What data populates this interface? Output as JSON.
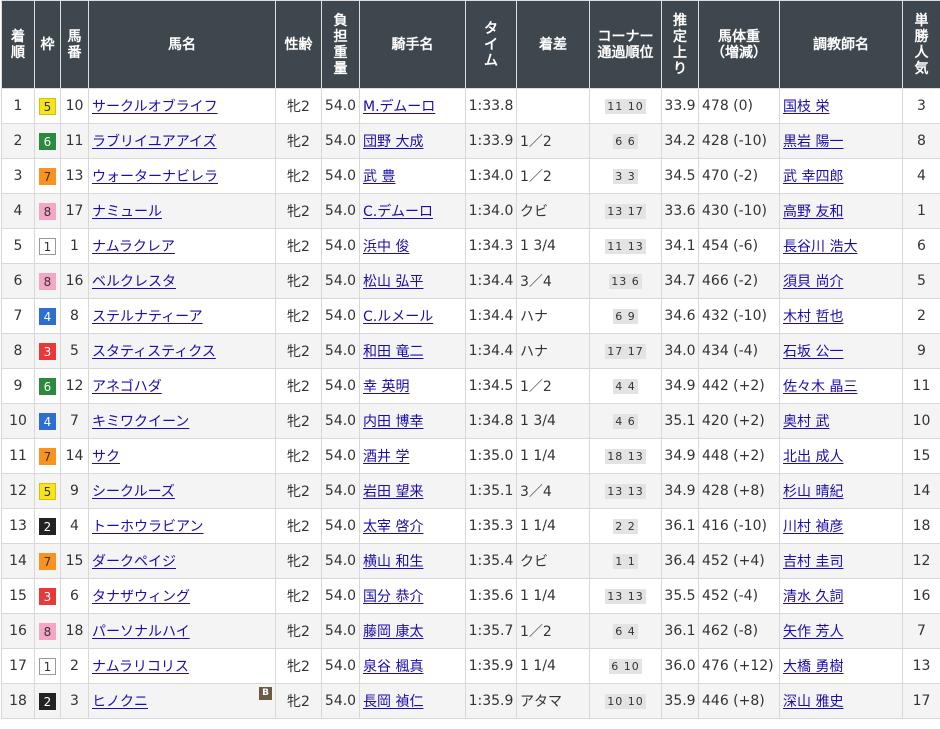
{
  "headers": [
    "着\n順",
    "枠",
    "馬\n番",
    "馬名",
    "性齢",
    "負\n担\n重\n量",
    "騎手名",
    "タ\nイ\nム",
    "着差",
    "コーナー\n通過順位",
    "推\n定\n上\nり",
    "馬体重\n（増減）",
    "調教師名",
    "単\n勝\n人\n気"
  ],
  "rows": [
    {
      "rank": "1",
      "waku": "5",
      "umaban": "10",
      "horse": "サークルオブライフ",
      "sex_age": "牝2",
      "weight": "54.0",
      "jockey": "M.デムーロ",
      "time": "1:33.8",
      "margin": "",
      "corner": "11 10",
      "last3f": "33.9",
      "body_weight": "478 (0)",
      "trainer": "国枝 栄",
      "popularity": "3",
      "blinker": ""
    },
    {
      "rank": "2",
      "waku": "6",
      "umaban": "11",
      "horse": "ラブリイユアアイズ",
      "sex_age": "牝2",
      "weight": "54.0",
      "jockey": "団野 大成",
      "time": "1:33.9",
      "margin": "1／2",
      "corner": "6 6",
      "last3f": "34.2",
      "body_weight": "428 (-10)",
      "trainer": "黒岩 陽一",
      "popularity": "8",
      "blinker": ""
    },
    {
      "rank": "3",
      "waku": "7",
      "umaban": "13",
      "horse": "ウォーターナビレラ",
      "sex_age": "牝2",
      "weight": "54.0",
      "jockey": "武 豊",
      "time": "1:34.0",
      "margin": "1／2",
      "corner": "3 3",
      "last3f": "34.5",
      "body_weight": "470 (-2)",
      "trainer": "武 幸四郎",
      "popularity": "4",
      "blinker": ""
    },
    {
      "rank": "4",
      "waku": "8",
      "umaban": "17",
      "horse": "ナミュール",
      "sex_age": "牝2",
      "weight": "54.0",
      "jockey": "C.デムーロ",
      "time": "1:34.0",
      "margin": "クビ",
      "corner": "13 17",
      "last3f": "33.6",
      "body_weight": "430 (-10)",
      "trainer": "高野 友和",
      "popularity": "1",
      "blinker": ""
    },
    {
      "rank": "5",
      "waku": "1",
      "umaban": "1",
      "horse": "ナムラクレア",
      "sex_age": "牝2",
      "weight": "54.0",
      "jockey": "浜中 俊",
      "time": "1:34.3",
      "margin": "1 3/4",
      "corner": "11 13",
      "last3f": "34.1",
      "body_weight": "454 (-6)",
      "trainer": "長谷川 浩大",
      "popularity": "6",
      "blinker": ""
    },
    {
      "rank": "6",
      "waku": "8",
      "umaban": "16",
      "horse": "ベルクレスタ",
      "sex_age": "牝2",
      "weight": "54.0",
      "jockey": "松山 弘平",
      "time": "1:34.4",
      "margin": "3／4",
      "corner": "13 6",
      "last3f": "34.7",
      "body_weight": "466 (-2)",
      "trainer": "須貝 尚介",
      "popularity": "5",
      "blinker": ""
    },
    {
      "rank": "7",
      "waku": "4",
      "umaban": "8",
      "horse": "ステルナティーア",
      "sex_age": "牝2",
      "weight": "54.0",
      "jockey": "C.ルメール",
      "time": "1:34.4",
      "margin": "ハナ",
      "corner": "6 9",
      "last3f": "34.6",
      "body_weight": "432 (-10)",
      "trainer": "木村 哲也",
      "popularity": "2",
      "blinker": ""
    },
    {
      "rank": "8",
      "waku": "3",
      "umaban": "5",
      "horse": "スタティスティクス",
      "sex_age": "牝2",
      "weight": "54.0",
      "jockey": "和田 竜二",
      "time": "1:34.4",
      "margin": "ハナ",
      "corner": "17 17",
      "last3f": "34.0",
      "body_weight": "434 (-4)",
      "trainer": "石坂 公一",
      "popularity": "9",
      "blinker": ""
    },
    {
      "rank": "9",
      "waku": "6",
      "umaban": "12",
      "horse": "アネゴハダ",
      "sex_age": "牝2",
      "weight": "54.0",
      "jockey": "幸 英明",
      "time": "1:34.5",
      "margin": "1／2",
      "corner": "4 4",
      "last3f": "34.9",
      "body_weight": "442 (+2)",
      "trainer": "佐々木 晶三",
      "popularity": "11",
      "blinker": ""
    },
    {
      "rank": "10",
      "waku": "4",
      "umaban": "7",
      "horse": "キミワクイーン",
      "sex_age": "牝2",
      "weight": "54.0",
      "jockey": "内田 博幸",
      "time": "1:34.8",
      "margin": "1 3/4",
      "corner": "4 6",
      "last3f": "35.1",
      "body_weight": "420 (+2)",
      "trainer": "奥村 武",
      "popularity": "10",
      "blinker": ""
    },
    {
      "rank": "11",
      "waku": "7",
      "umaban": "14",
      "horse": "サク",
      "sex_age": "牝2",
      "weight": "54.0",
      "jockey": "酒井 学",
      "time": "1:35.0",
      "margin": "1 1/4",
      "corner": "18 13",
      "last3f": "34.9",
      "body_weight": "448 (+2)",
      "trainer": "北出 成人",
      "popularity": "15",
      "blinker": ""
    },
    {
      "rank": "12",
      "waku": "5",
      "umaban": "9",
      "horse": "シークルーズ",
      "sex_age": "牝2",
      "weight": "54.0",
      "jockey": "岩田 望来",
      "time": "1:35.1",
      "margin": "3／4",
      "corner": "13 13",
      "last3f": "34.9",
      "body_weight": "428 (+8)",
      "trainer": "杉山 晴紀",
      "popularity": "14",
      "blinker": ""
    },
    {
      "rank": "13",
      "waku": "2",
      "umaban": "4",
      "horse": "トーホウラビアン",
      "sex_age": "牝2",
      "weight": "54.0",
      "jockey": "太宰 啓介",
      "time": "1:35.3",
      "margin": "1 1/4",
      "corner": "2 2",
      "last3f": "36.1",
      "body_weight": "416 (-10)",
      "trainer": "川村 禎彦",
      "popularity": "18",
      "blinker": ""
    },
    {
      "rank": "14",
      "waku": "7",
      "umaban": "15",
      "horse": "ダークペイジ",
      "sex_age": "牝2",
      "weight": "54.0",
      "jockey": "横山 和生",
      "time": "1:35.4",
      "margin": "クビ",
      "corner": "1 1",
      "last3f": "36.4",
      "body_weight": "452 (+4)",
      "trainer": "吉村 圭司",
      "popularity": "12",
      "blinker": ""
    },
    {
      "rank": "15",
      "waku": "3",
      "umaban": "6",
      "horse": "タナザウィング",
      "sex_age": "牝2",
      "weight": "54.0",
      "jockey": "国分 恭介",
      "time": "1:35.6",
      "margin": "1 1/4",
      "corner": "13 13",
      "last3f": "35.5",
      "body_weight": "452 (-4)",
      "trainer": "清水 久詞",
      "popularity": "16",
      "blinker": ""
    },
    {
      "rank": "16",
      "waku": "8",
      "umaban": "18",
      "horse": "パーソナルハイ",
      "sex_age": "牝2",
      "weight": "54.0",
      "jockey": "藤岡 康太",
      "time": "1:35.7",
      "margin": "1／2",
      "corner": "6 4",
      "last3f": "36.1",
      "body_weight": "462 (-8)",
      "trainer": "矢作 芳人",
      "popularity": "7",
      "blinker": ""
    },
    {
      "rank": "17",
      "waku": "1",
      "umaban": "2",
      "horse": "ナムラリコリス",
      "sex_age": "牝2",
      "weight": "54.0",
      "jockey": "泉谷 楓真",
      "time": "1:35.9",
      "margin": "1 1/4",
      "corner": "6 10",
      "last3f": "36.0",
      "body_weight": "476 (+12)",
      "trainer": "大橋 勇樹",
      "popularity": "13",
      "blinker": ""
    },
    {
      "rank": "18",
      "waku": "2",
      "umaban": "3",
      "horse": "ヒノクニ",
      "sex_age": "牝2",
      "weight": "54.0",
      "jockey": "長岡 禎仁",
      "time": "1:35.9",
      "margin": "アタマ",
      "corner": "10 10",
      "last3f": "35.9",
      "body_weight": "446 (+8)",
      "trainer": "深山 雅史",
      "popularity": "17",
      "blinker": "B"
    }
  ]
}
